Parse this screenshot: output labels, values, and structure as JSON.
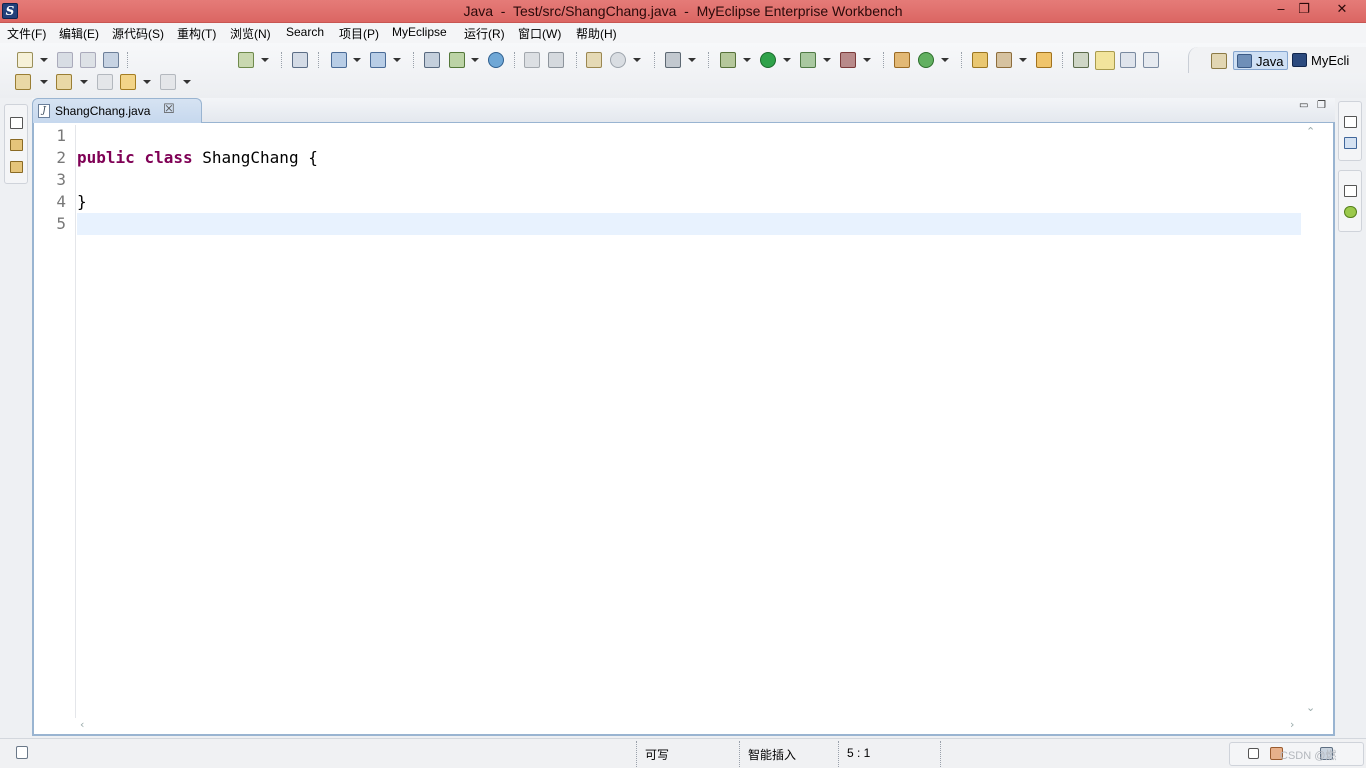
{
  "window": {
    "title": "Java  -  Test/src/ShangChang.java  -  MyEclipse Enterprise Workbench",
    "minimize_symbol": "‒",
    "restore_symbol": "❐",
    "close_symbol": "✕"
  },
  "menubar": {
    "items": [
      {
        "label": "文件(F)"
      },
      {
        "label": "编辑(E)"
      },
      {
        "label": "源代码(S)"
      },
      {
        "label": "重构(T)"
      },
      {
        "label": "浏览(N)"
      },
      {
        "label": "Search"
      },
      {
        "label": "项目(P)"
      },
      {
        "label": "MyEclipse"
      },
      {
        "label": "运行(R)"
      },
      {
        "label": "窗口(W)"
      },
      {
        "label": "帮助(H)"
      }
    ]
  },
  "perspectives": {
    "items": [
      {
        "label": "Java",
        "active": true
      },
      {
        "label": "MyEcli",
        "active": false
      }
    ]
  },
  "editor": {
    "tab": {
      "label": "ShangChang.java",
      "close": "☒",
      "icon": "java-file-icon"
    },
    "lines": [
      {
        "number": "1",
        "keywords": [],
        "text": ""
      },
      {
        "number": "2",
        "keywords": [
          "public",
          "class"
        ],
        "text": " ShangChang {"
      },
      {
        "number": "3",
        "keywords": [],
        "text": ""
      },
      {
        "number": "4",
        "keywords": [],
        "text": "}"
      },
      {
        "number": "5",
        "keywords": [],
        "text": ""
      }
    ],
    "current_line": 5,
    "keyword_color": "#7f0055"
  },
  "statusbar": {
    "writable": "可写",
    "insert_mode": "智能插入",
    "cursor_position": "5 : 1",
    "watermark": "CSDN @燃"
  },
  "colors": {
    "titlebar": "#e06e6b",
    "tab_active": "#c6d8ee",
    "editor_border": "#99b4d1",
    "current_line": "#e8f2fe"
  }
}
